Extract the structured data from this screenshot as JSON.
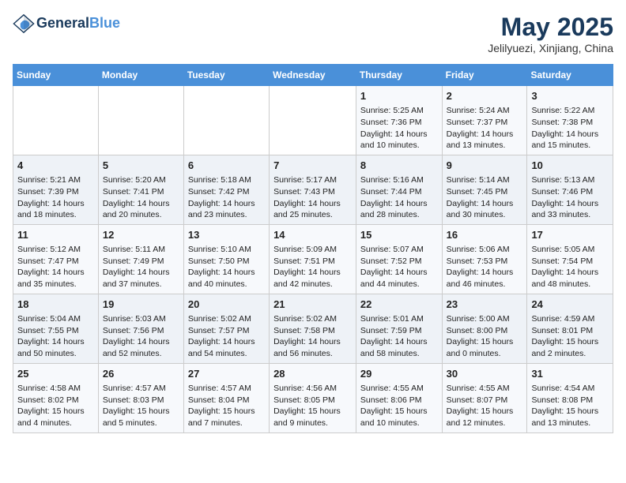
{
  "header": {
    "logo_line1": "General",
    "logo_line2": "Blue",
    "month": "May 2025",
    "location": "Jelilyuezi, Xinjiang, China"
  },
  "weekdays": [
    "Sunday",
    "Monday",
    "Tuesday",
    "Wednesday",
    "Thursday",
    "Friday",
    "Saturday"
  ],
  "weeks": [
    [
      {
        "day": "",
        "info": ""
      },
      {
        "day": "",
        "info": ""
      },
      {
        "day": "",
        "info": ""
      },
      {
        "day": "",
        "info": ""
      },
      {
        "day": "1",
        "info": "Sunrise: 5:25 AM\nSunset: 7:36 PM\nDaylight: 14 hours\nand 10 minutes."
      },
      {
        "day": "2",
        "info": "Sunrise: 5:24 AM\nSunset: 7:37 PM\nDaylight: 14 hours\nand 13 minutes."
      },
      {
        "day": "3",
        "info": "Sunrise: 5:22 AM\nSunset: 7:38 PM\nDaylight: 14 hours\nand 15 minutes."
      }
    ],
    [
      {
        "day": "4",
        "info": "Sunrise: 5:21 AM\nSunset: 7:39 PM\nDaylight: 14 hours\nand 18 minutes."
      },
      {
        "day": "5",
        "info": "Sunrise: 5:20 AM\nSunset: 7:41 PM\nDaylight: 14 hours\nand 20 minutes."
      },
      {
        "day": "6",
        "info": "Sunrise: 5:18 AM\nSunset: 7:42 PM\nDaylight: 14 hours\nand 23 minutes."
      },
      {
        "day": "7",
        "info": "Sunrise: 5:17 AM\nSunset: 7:43 PM\nDaylight: 14 hours\nand 25 minutes."
      },
      {
        "day": "8",
        "info": "Sunrise: 5:16 AM\nSunset: 7:44 PM\nDaylight: 14 hours\nand 28 minutes."
      },
      {
        "day": "9",
        "info": "Sunrise: 5:14 AM\nSunset: 7:45 PM\nDaylight: 14 hours\nand 30 minutes."
      },
      {
        "day": "10",
        "info": "Sunrise: 5:13 AM\nSunset: 7:46 PM\nDaylight: 14 hours\nand 33 minutes."
      }
    ],
    [
      {
        "day": "11",
        "info": "Sunrise: 5:12 AM\nSunset: 7:47 PM\nDaylight: 14 hours\nand 35 minutes."
      },
      {
        "day": "12",
        "info": "Sunrise: 5:11 AM\nSunset: 7:49 PM\nDaylight: 14 hours\nand 37 minutes."
      },
      {
        "day": "13",
        "info": "Sunrise: 5:10 AM\nSunset: 7:50 PM\nDaylight: 14 hours\nand 40 minutes."
      },
      {
        "day": "14",
        "info": "Sunrise: 5:09 AM\nSunset: 7:51 PM\nDaylight: 14 hours\nand 42 minutes."
      },
      {
        "day": "15",
        "info": "Sunrise: 5:07 AM\nSunset: 7:52 PM\nDaylight: 14 hours\nand 44 minutes."
      },
      {
        "day": "16",
        "info": "Sunrise: 5:06 AM\nSunset: 7:53 PM\nDaylight: 14 hours\nand 46 minutes."
      },
      {
        "day": "17",
        "info": "Sunrise: 5:05 AM\nSunset: 7:54 PM\nDaylight: 14 hours\nand 48 minutes."
      }
    ],
    [
      {
        "day": "18",
        "info": "Sunrise: 5:04 AM\nSunset: 7:55 PM\nDaylight: 14 hours\nand 50 minutes."
      },
      {
        "day": "19",
        "info": "Sunrise: 5:03 AM\nSunset: 7:56 PM\nDaylight: 14 hours\nand 52 minutes."
      },
      {
        "day": "20",
        "info": "Sunrise: 5:02 AM\nSunset: 7:57 PM\nDaylight: 14 hours\nand 54 minutes."
      },
      {
        "day": "21",
        "info": "Sunrise: 5:02 AM\nSunset: 7:58 PM\nDaylight: 14 hours\nand 56 minutes."
      },
      {
        "day": "22",
        "info": "Sunrise: 5:01 AM\nSunset: 7:59 PM\nDaylight: 14 hours\nand 58 minutes."
      },
      {
        "day": "23",
        "info": "Sunrise: 5:00 AM\nSunset: 8:00 PM\nDaylight: 15 hours\nand 0 minutes."
      },
      {
        "day": "24",
        "info": "Sunrise: 4:59 AM\nSunset: 8:01 PM\nDaylight: 15 hours\nand 2 minutes."
      }
    ],
    [
      {
        "day": "25",
        "info": "Sunrise: 4:58 AM\nSunset: 8:02 PM\nDaylight: 15 hours\nand 4 minutes."
      },
      {
        "day": "26",
        "info": "Sunrise: 4:57 AM\nSunset: 8:03 PM\nDaylight: 15 hours\nand 5 minutes."
      },
      {
        "day": "27",
        "info": "Sunrise: 4:57 AM\nSunset: 8:04 PM\nDaylight: 15 hours\nand 7 minutes."
      },
      {
        "day": "28",
        "info": "Sunrise: 4:56 AM\nSunset: 8:05 PM\nDaylight: 15 hours\nand 9 minutes."
      },
      {
        "day": "29",
        "info": "Sunrise: 4:55 AM\nSunset: 8:06 PM\nDaylight: 15 hours\nand 10 minutes."
      },
      {
        "day": "30",
        "info": "Sunrise: 4:55 AM\nSunset: 8:07 PM\nDaylight: 15 hours\nand 12 minutes."
      },
      {
        "day": "31",
        "info": "Sunrise: 4:54 AM\nSunset: 8:08 PM\nDaylight: 15 hours\nand 13 minutes."
      }
    ]
  ]
}
